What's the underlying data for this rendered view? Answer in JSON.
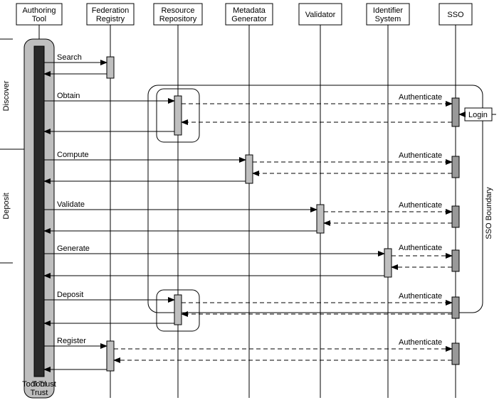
{
  "participants": [
    {
      "id": "authoring",
      "name": "Authoring Tool"
    },
    {
      "id": "federation",
      "name": "Federation Registry"
    },
    {
      "id": "resource",
      "name": "Resource Repository"
    },
    {
      "id": "metadata",
      "name": "Metadata Generator"
    },
    {
      "id": "validator",
      "name": "Validator"
    },
    {
      "id": "identifier",
      "name": "Identifier System"
    },
    {
      "id": "sso",
      "name": "SSO"
    }
  ],
  "phases": [
    {
      "name": "Discover"
    },
    {
      "name": "Deposit"
    }
  ],
  "messages": {
    "search": "Search",
    "obtain": "Obtain",
    "compute": "Compute",
    "validate": "Validate",
    "generate": "Generate",
    "deposit": "Deposit",
    "register": "Register",
    "authenticate": "Authenticate",
    "login": "Login"
  },
  "footer": {
    "toolTrust": "Tool Trust"
  },
  "ssoBoundary": "SSO Boundary",
  "chart_data": {
    "type": "sequence",
    "participants": [
      "Authoring Tool",
      "Federation Registry",
      "Resource Repository",
      "Metadata Generator",
      "Validator",
      "Identifier System",
      "SSO"
    ],
    "interactions": [
      {
        "phase": "Discover",
        "from": "Authoring Tool",
        "to": "Federation Registry",
        "label": "Search",
        "return": true
      },
      {
        "phase": "Discover",
        "from": "Authoring Tool",
        "to": "Resource Repository",
        "label": "Obtain",
        "return": true,
        "auth": {
          "via": "SSO",
          "label": "Authenticate",
          "external": "Login"
        }
      },
      {
        "phase": "Deposit",
        "from": "Authoring Tool",
        "to": "Metadata Generator",
        "label": "Compute",
        "return": true,
        "auth": {
          "via": "SSO",
          "label": "Authenticate"
        }
      },
      {
        "phase": "Deposit",
        "from": "Authoring Tool",
        "to": "Validator",
        "label": "Validate",
        "return": true,
        "auth": {
          "via": "SSO",
          "label": "Authenticate"
        }
      },
      {
        "phase": "Deposit",
        "from": "Authoring Tool",
        "to": "Identifier System",
        "label": "Generate",
        "return": true,
        "auth": {
          "via": "SSO",
          "label": "Authenticate"
        }
      },
      {
        "phase": "Deposit",
        "from": "Authoring Tool",
        "to": "Resource Repository",
        "label": "Deposit",
        "return": true,
        "auth": {
          "via": "SSO",
          "label": "Authenticate"
        }
      },
      {
        "phase": "Deposit",
        "from": "Authoring Tool",
        "to": "Federation Registry",
        "label": "Register",
        "return": true,
        "auth": {
          "via": "SSO",
          "label": "Authenticate"
        }
      }
    ],
    "boundary": "SSO Boundary",
    "trust": "Tool Trust"
  }
}
